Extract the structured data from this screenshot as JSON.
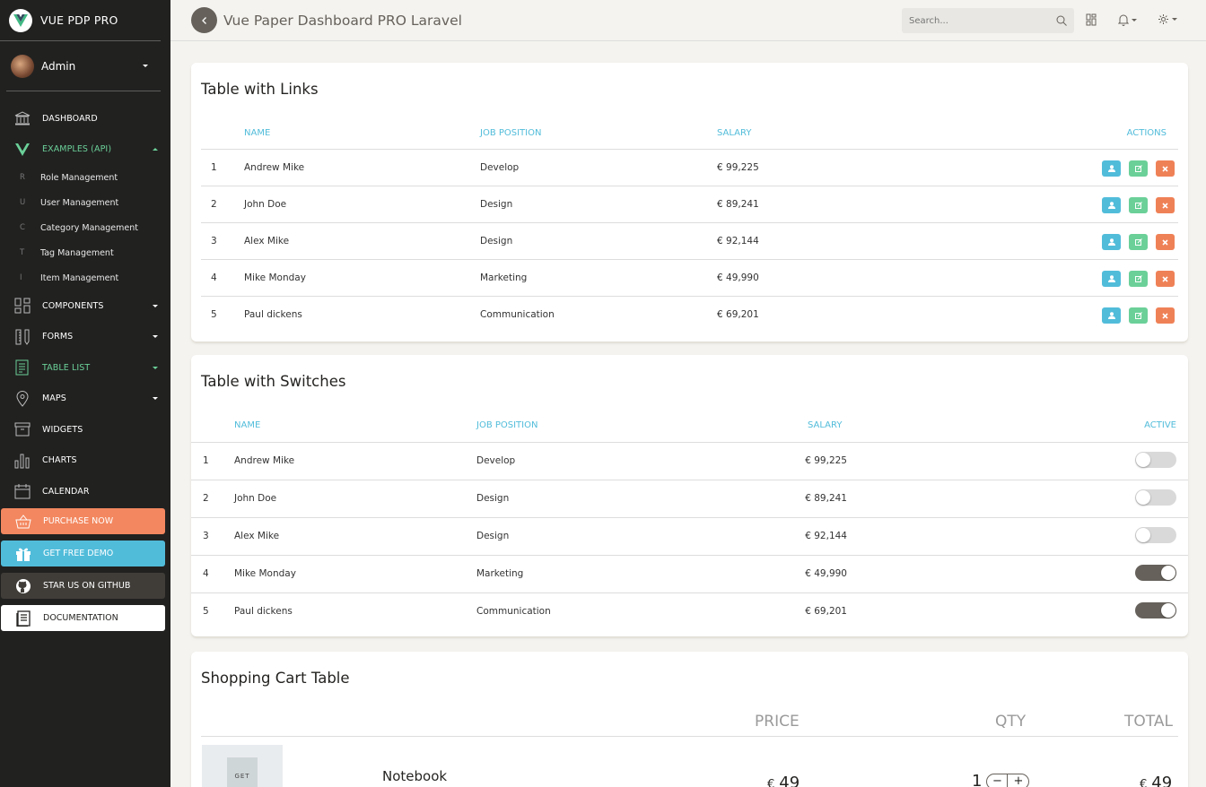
{
  "app": {
    "brand": "VUE PDP PRO",
    "user": "Admin",
    "page_title": "Vue Paper Dashboard PRO Laravel"
  },
  "search": {
    "placeholder": "Search..."
  },
  "nav": {
    "dashboard": "DASHBOARD",
    "examples": "EXAMPLES (API)",
    "sub": [
      {
        "mini": "R",
        "label": "Role Management"
      },
      {
        "mini": "U",
        "label": "User Management"
      },
      {
        "mini": "C",
        "label": "Category Management"
      },
      {
        "mini": "T",
        "label": "Tag Management"
      },
      {
        "mini": "I",
        "label": "Item Management"
      }
    ],
    "components": "COMPONENTS",
    "forms": "FORMS",
    "table_list": "TABLE LIST",
    "maps": "MAPS",
    "widgets": "WIDGETS",
    "charts": "CHARTS",
    "calendar": "CALENDAR",
    "purchase": "PURCHASE NOW",
    "demo": "GET FREE DEMO",
    "github": "STAR US ON GITHUB",
    "docs": "DOCUMENTATION"
  },
  "colors": {
    "sidebar": "#212120",
    "accent_green": "#6bd098",
    "info": "#51bcda",
    "danger": "#ef8157",
    "warning_orange": "#f3875f"
  },
  "links_table": {
    "title": "Table with Links",
    "headers": {
      "name": "NAME",
      "job": "JOB POSITION",
      "salary": "SALARY",
      "actions": "ACTIONS"
    },
    "rows": [
      {
        "id": "1",
        "name": "Andrew Mike",
        "job": "Develop",
        "salary": "€ 99,225"
      },
      {
        "id": "2",
        "name": "John Doe",
        "job": "Design",
        "salary": "€ 89,241"
      },
      {
        "id": "3",
        "name": "Alex Mike",
        "job": "Design",
        "salary": "€ 92,144"
      },
      {
        "id": "4",
        "name": "Mike Monday",
        "job": "Marketing",
        "salary": "€ 49,990"
      },
      {
        "id": "5",
        "name": "Paul dickens",
        "job": "Communication",
        "salary": "€ 69,201"
      }
    ]
  },
  "switch_table": {
    "title": "Table with Switches",
    "headers": {
      "name": "NAME",
      "job": "JOB POSITION",
      "salary": "SALARY",
      "active": "ACTIVE"
    },
    "rows": [
      {
        "id": "1",
        "name": "Andrew Mike",
        "job": "Develop",
        "salary": "€ 99,225",
        "active": false
      },
      {
        "id": "2",
        "name": "John Doe",
        "job": "Design",
        "salary": "€ 89,241",
        "active": false
      },
      {
        "id": "3",
        "name": "Alex Mike",
        "job": "Design",
        "salary": "€ 92,144",
        "active": false
      },
      {
        "id": "4",
        "name": "Mike Monday",
        "job": "Marketing",
        "salary": "€ 49,990",
        "active": true
      },
      {
        "id": "5",
        "name": "Paul dickens",
        "job": "Communication",
        "salary": "€ 69,201",
        "active": true
      }
    ]
  },
  "cart": {
    "title": "Shopping Cart Table",
    "headers": {
      "price": "PRICE",
      "qty": "QTY",
      "total": "TOTAL"
    },
    "item": {
      "name": "Notebook",
      "price_currency": "€",
      "price": "49",
      "qty": "1",
      "total_currency": "€",
      "total": "49",
      "image_text": "GET"
    }
  }
}
